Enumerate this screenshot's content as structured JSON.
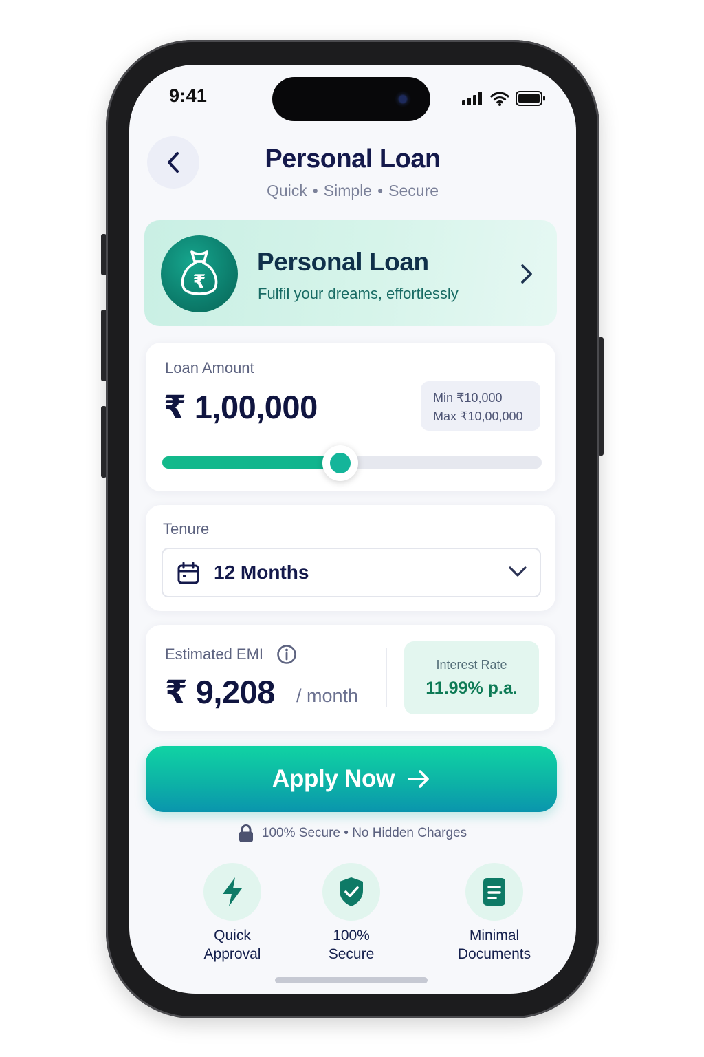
{
  "status_bar": {
    "time": "9:41"
  },
  "header": {
    "title": "Personal Loan",
    "subtitle_parts": [
      "Quick",
      "Simple",
      "Secure"
    ],
    "subtitle_separator": "•"
  },
  "hero": {
    "title": "Personal Loan",
    "subtitle": "Fulfil your dreams, effortlessly",
    "icon": "money-bag-rupee-icon"
  },
  "loan_amount": {
    "label": "Loan Amount",
    "value": "₹ 1,00,000",
    "min_text": "Min ₹10,000",
    "max_text": "Max ₹10,00,000",
    "slider_fraction": 0.47
  },
  "tenure": {
    "label": "Tenure",
    "selected": "12 Months"
  },
  "emi": {
    "label": "Estimated EMI",
    "value": "₹ 9,208",
    "unit": "/ month",
    "interest_label": "Interest Rate",
    "interest_value": "11.99% p.a."
  },
  "cta": {
    "label": "Apply Now"
  },
  "secure_note": {
    "text": "100% Secure • No Hidden Charges"
  },
  "features": [
    {
      "line1": "Quick",
      "line2": "Approval",
      "icon": "lightning-icon"
    },
    {
      "line1": "100%",
      "line2": "Secure",
      "icon": "shield-check-icon"
    },
    {
      "line1": "Minimal",
      "line2": "Documents",
      "icon": "document-icon"
    }
  ],
  "colors": {
    "accent": "#13b98b",
    "navy": "#14194b",
    "interest_green": "#0d7a55"
  }
}
